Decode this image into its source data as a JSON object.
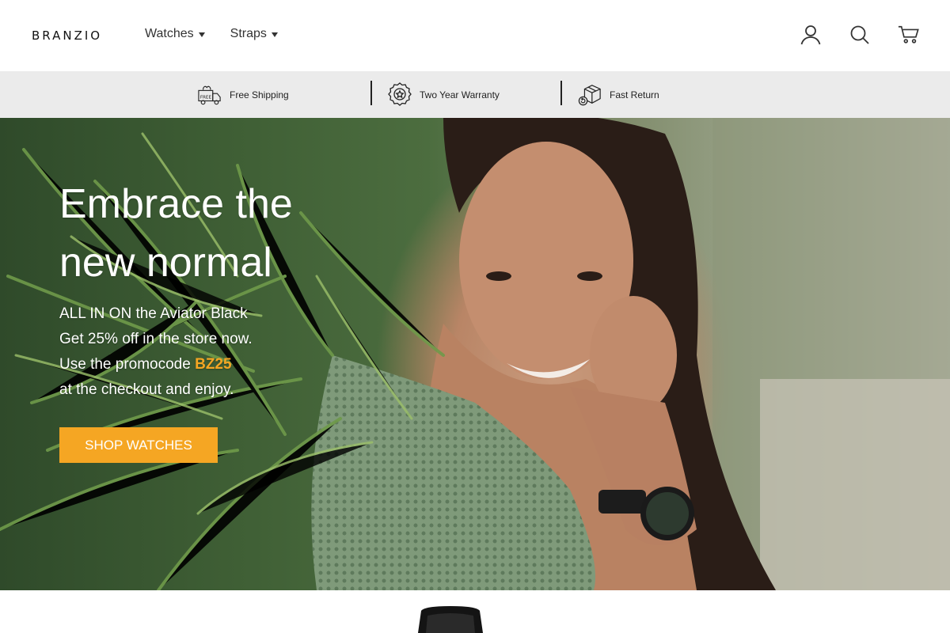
{
  "brand": {
    "logo": "BRANZIO",
    "accent": "#f5a623"
  },
  "nav": {
    "items": [
      {
        "label": "Watches"
      },
      {
        "label": "Straps"
      }
    ]
  },
  "header_icons": [
    "user-icon",
    "search-icon",
    "cart-icon"
  ],
  "benefits": [
    {
      "label": "Free Shipping",
      "icon": "free-shipping-truck-icon",
      "badge": "FREE"
    },
    {
      "label": "Two Year Warranty",
      "icon": "warranty-medal-icon"
    },
    {
      "label": "Fast Return",
      "icon": "fast-return-box-icon"
    }
  ],
  "hero": {
    "title_line1": "Embrace the",
    "title_line2": "new normal",
    "copy_line1": "ALL IN ON the Aviator Black",
    "copy_line2": "Get 25% off in the store now.",
    "copy_line3_prefix": "Use the promocode ",
    "promo_code": "BZ25",
    "copy_line4": "at the checkout and enjoy.",
    "cta_label": "SHOP WATCHES"
  },
  "colors": {
    "benefits_bg": "#ebebeb",
    "cta_bg": "#f5a623",
    "text_dark": "#222222"
  }
}
